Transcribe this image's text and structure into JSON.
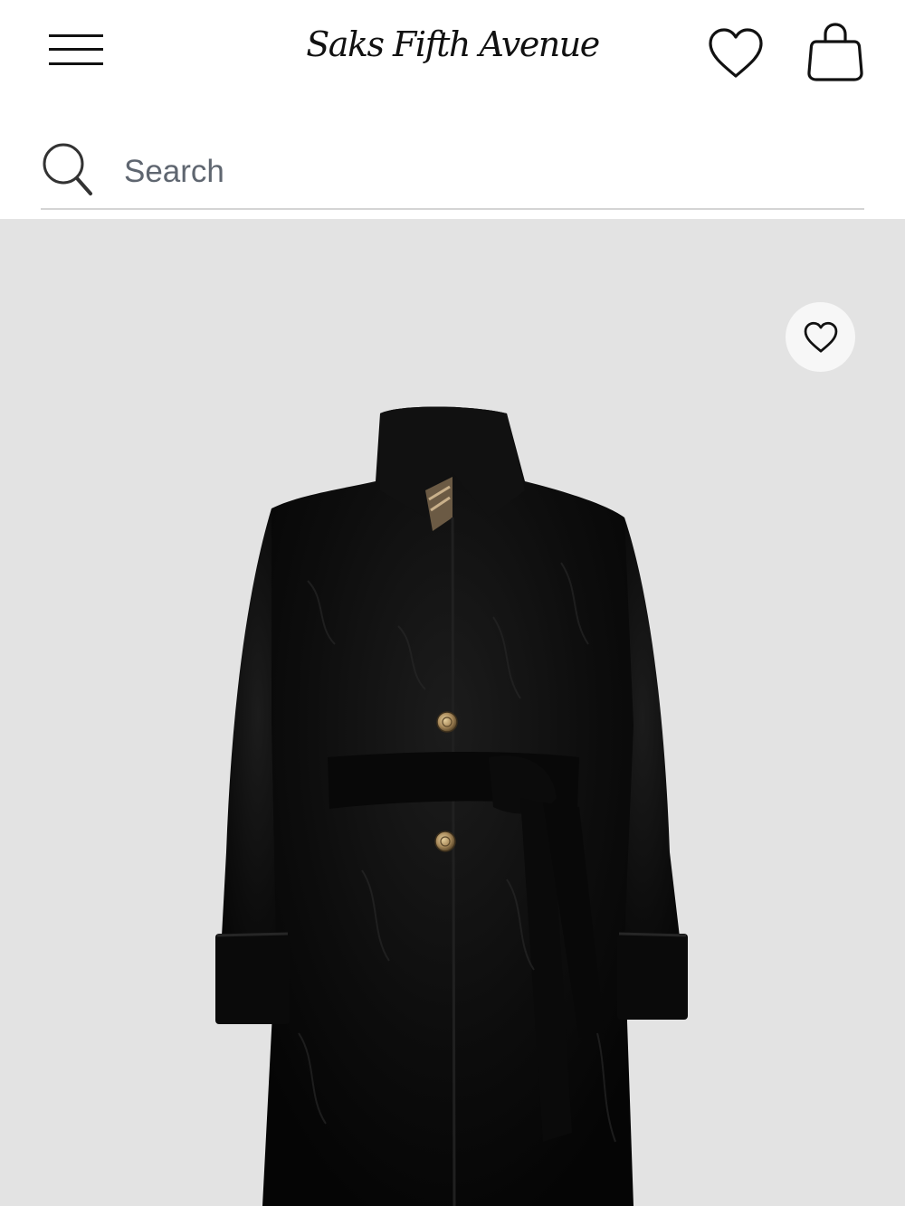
{
  "header": {
    "logo_text": "Saks Fifth Avenue",
    "menu_icon": "hamburger-menu-icon",
    "wishlist_icon": "heart-icon",
    "bag_icon": "shopping-bag-icon"
  },
  "search": {
    "placeholder": "Search",
    "value": "",
    "icon": "search-icon"
  },
  "product": {
    "background_color": "#e3e3e3",
    "image_subject": "black faux fur belted coat",
    "wishlist_icon": "heart-icon"
  },
  "colors": {
    "text": "#111111",
    "placeholder": "#5f6670",
    "divider": "#d4d4d4",
    "coat": "#0c0c0c",
    "button_gold": "#a8895a"
  }
}
